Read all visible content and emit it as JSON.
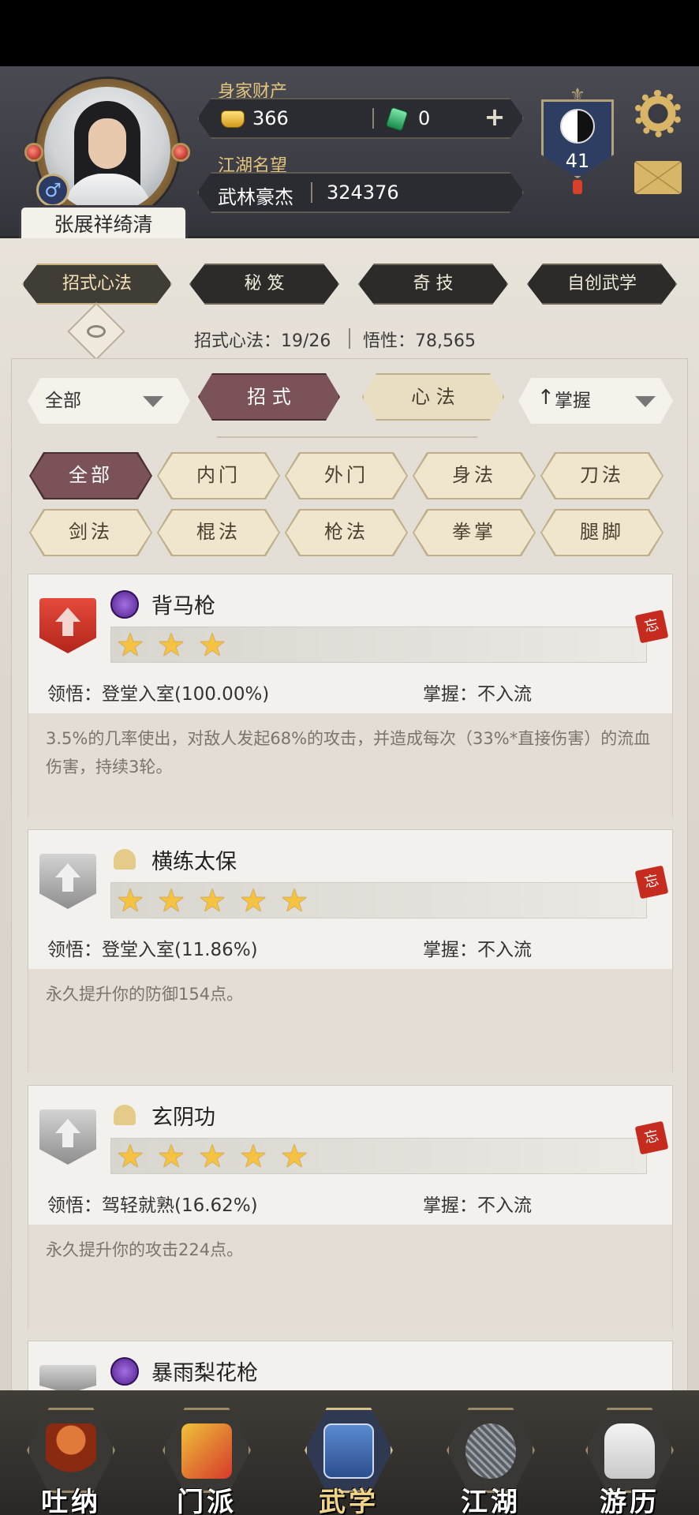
{
  "player": {
    "name": "张展祥绮清",
    "gender_symbol": "♂",
    "wealth_label": "身家财产",
    "gold": "366",
    "jade": "0",
    "fame_label": "江湖名望",
    "fame_title": "武林豪杰",
    "fame_value": "324376",
    "level": "41"
  },
  "top_tabs": [
    "招式心法",
    "秘 笈",
    "奇 技",
    "自创武学"
  ],
  "stats": {
    "moves_text": "招式心法：19/26",
    "insight_text": "悟性：78,565"
  },
  "filters": {
    "category_dropdown": "全部",
    "segment_moves": "招 式",
    "segment_mind": "心 法",
    "sort_dropdown": "掌握"
  },
  "chips": [
    "全部",
    "内门",
    "外门",
    "身法",
    "刀法",
    "剑法",
    "棍法",
    "枪法",
    "拳掌",
    "腿脚"
  ],
  "skills": [
    {
      "name": "背马枪",
      "stars": 3,
      "rank": "red",
      "type_icon": "purple-orb-icon",
      "comprehension": "领悟：登堂入室(100.00%)",
      "mastery": "掌握：不入流",
      "description": "3.5%的几率使出，对敌人发起68%的攻击，并造成每次（33%*直接伤害）的流血伤害，持续3轮。"
    },
    {
      "name": "横练太保",
      "stars": 5,
      "rank": "grey",
      "type_icon": "gold-bell-icon",
      "comprehension": "领悟：登堂入室(11.86%)",
      "mastery": "掌握：不入流",
      "description": "永久提升你的防御154点。"
    },
    {
      "name": "玄阴功",
      "stars": 5,
      "rank": "grey",
      "type_icon": "gold-bell-icon",
      "comprehension": "领悟：驾轻就熟(16.62%)",
      "mastery": "掌握：不入流",
      "description": "永久提升你的攻击224点。"
    },
    {
      "name": "暴雨梨花枪",
      "stars": 0,
      "rank": "grey",
      "type_icon": "purple-orb-icon"
    }
  ],
  "forget_tag": "忘",
  "bottom_nav": [
    "吐纳",
    "门派",
    "武学",
    "江湖",
    "游历"
  ],
  "colors": {
    "accent_maroon": "#7a5257",
    "gold_text": "#e4c57e",
    "star": "#f5c242"
  }
}
